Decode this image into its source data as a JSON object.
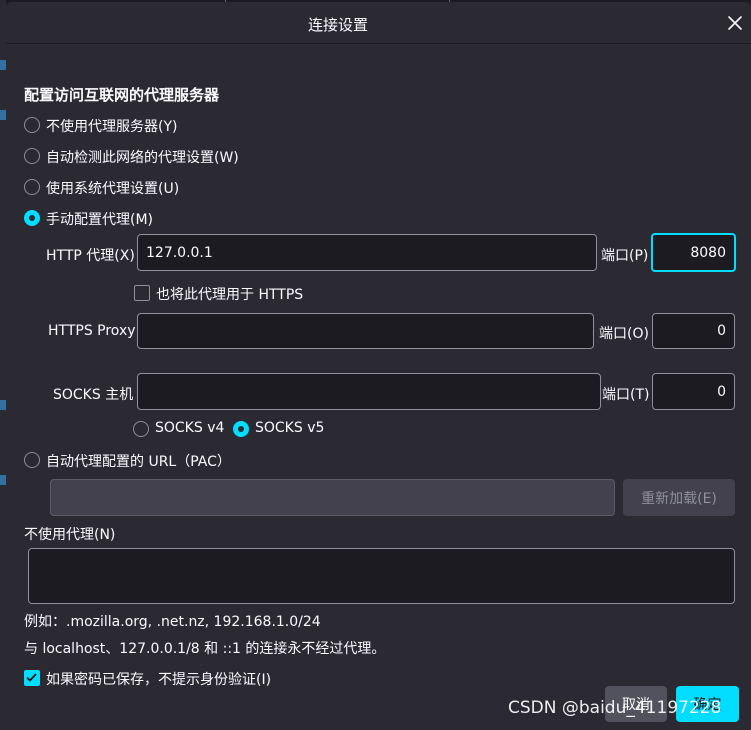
{
  "dialog": {
    "title": "连接设置",
    "close_icon": "close-icon"
  },
  "section_heading": "配置访问互联网的代理服务器",
  "proxy_options": {
    "no_proxy": "不使用代理服务器(Y)",
    "auto_detect": "自动检测此网络的代理设置(W)",
    "system_proxy": "使用系统代理设置(U)",
    "manual_proxy": "手动配置代理(M)",
    "selected": "manual_proxy"
  },
  "http": {
    "label": "HTTP 代理(X)",
    "value": "127.0.0.1",
    "port_label": "端口(P)",
    "port_value": "8080"
  },
  "also_https": {
    "label": "也将此代理用于 HTTPS",
    "checked": false
  },
  "https": {
    "label": "HTTPS Proxy",
    "value": "",
    "port_label": "端口(O)",
    "port_value": "0"
  },
  "socks": {
    "label": "SOCKS 主机",
    "value": "",
    "port_label": "端口(T)",
    "port_value": "0",
    "v4_label": "SOCKS v4",
    "v5_label": "SOCKS v5",
    "selected_version": "v5"
  },
  "pac": {
    "label": "自动代理配置的 URL（PAC）",
    "value": "",
    "reload_label": "重新加载(E)"
  },
  "no_proxy_for": {
    "label": "不使用代理(N)",
    "value": "",
    "example": "例如：.mozilla.org, .net.nz, 192.168.1.0/24",
    "note": "与 localhost、127.0.0.1/8 和 ::1 的连接永不经过代理。"
  },
  "auth_prompt": {
    "label": "如果密码已保存，不提示身份验证(I)",
    "checked": true
  },
  "buttons": {
    "cancel": "取消",
    "ok": "确定"
  },
  "watermark": "CSDN @baidu_41197228",
  "colors": {
    "accent": "#00ddff",
    "background": "#2b2a33",
    "field": "#1c1b22"
  }
}
